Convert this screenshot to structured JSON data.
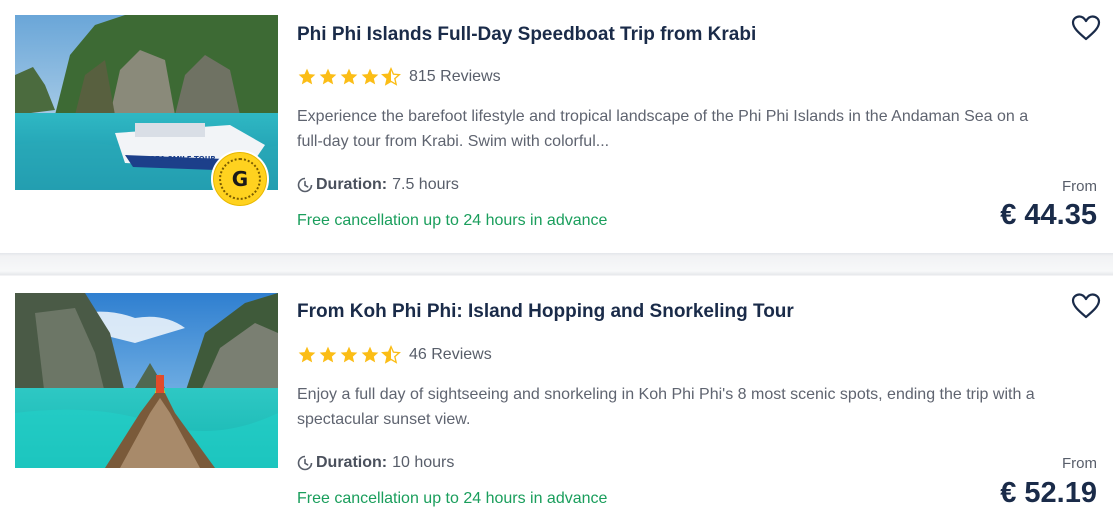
{
  "listings": [
    {
      "title": "Phi Phi Islands Full-Day Speedboat Trip from Krabi",
      "rating": 4.5,
      "reviews": "815 Reviews",
      "description": "Experience the barefoot lifestyle and tropical landscape of the Phi Phi Islands in the Andaman Sea on a full-day tour from Krabi. Swim with colorful...",
      "duration_label": "Duration:",
      "duration_value": "7.5 hours",
      "cancellation": "Free cancellation up to 24 hours in advance",
      "from_label": "From",
      "price": "€ 44.35",
      "boat_text": "SEA SMILE TOUR",
      "badge": "G"
    },
    {
      "title": "From Koh Phi Phi: Island Hopping and Snorkeling Tour",
      "rating": 4.5,
      "reviews": "46 Reviews",
      "description": "Enjoy a full day of sightseeing and snorkeling in Koh Phi Phi's 8 most scenic spots, ending the trip with a spectacular sunset view.",
      "duration_label": "Duration:",
      "duration_value": "10 hours",
      "cancellation": "Free cancellation up to 24 hours in advance",
      "from_label": "From",
      "price": "€ 52.19"
    }
  ],
  "icons": {
    "heart": "heart-outline-icon",
    "star": "star-icon",
    "clock": "clock-icon"
  },
  "colors": {
    "star": "#fbbd16",
    "cancellation": "#1a9e5c",
    "title": "#1a2b49"
  }
}
